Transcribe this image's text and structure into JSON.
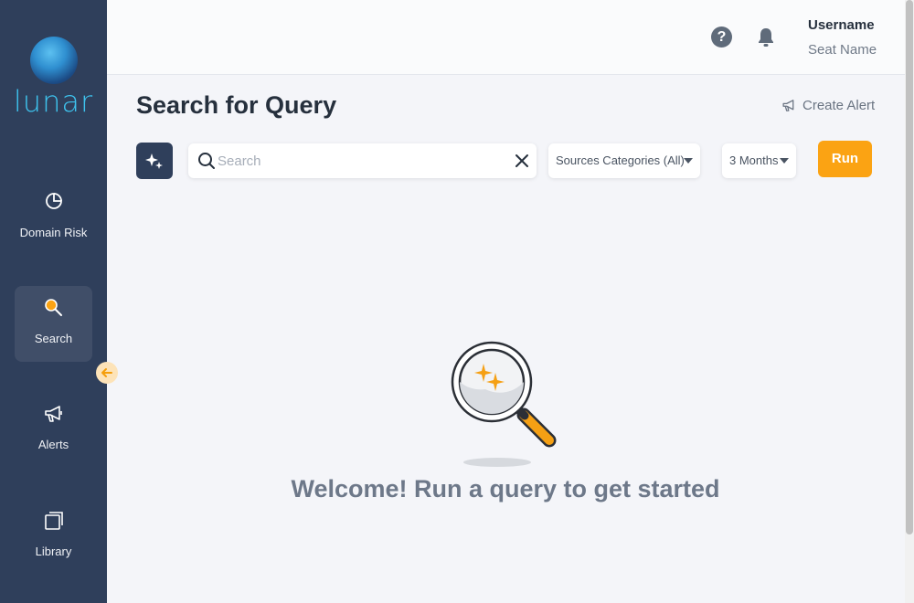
{
  "brand": {
    "name": "lunar"
  },
  "sidebar": {
    "items": [
      {
        "label": "Domain Risk",
        "icon": "pie-chart-icon"
      },
      {
        "label": "Search",
        "icon": "search-icon",
        "active": true
      },
      {
        "label": "Alerts",
        "icon": "megaphone-icon"
      },
      {
        "label": "Library",
        "icon": "library-icon"
      }
    ]
  },
  "header": {
    "username": "Username",
    "seat_name": "Seat Name"
  },
  "main": {
    "title": "Search for Query",
    "create_alert_label": "Create Alert",
    "search": {
      "placeholder": "Search",
      "value": ""
    },
    "sources_select": {
      "value": "Sources Categories (All)"
    },
    "period_select": {
      "value": "3 Months"
    },
    "run_label": "Run",
    "empty_message": "Welcome! Run a query to get started"
  },
  "colors": {
    "sidebar_bg": "#2f3f5b",
    "accent": "#fba313",
    "brand_text": "#3ec3ee"
  }
}
